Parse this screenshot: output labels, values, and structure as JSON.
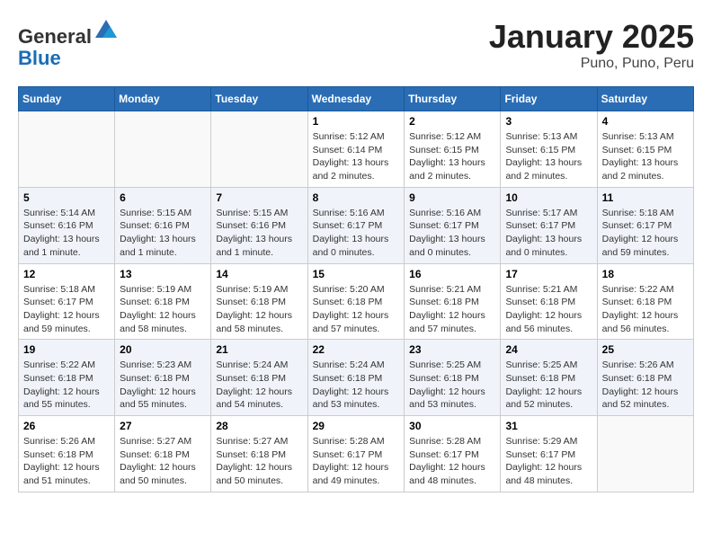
{
  "header": {
    "logo_general": "General",
    "logo_blue": "Blue",
    "month": "January 2025",
    "location": "Puno, Puno, Peru"
  },
  "weekdays": [
    "Sunday",
    "Monday",
    "Tuesday",
    "Wednesday",
    "Thursday",
    "Friday",
    "Saturday"
  ],
  "weeks": [
    [
      {
        "day": "",
        "info": ""
      },
      {
        "day": "",
        "info": ""
      },
      {
        "day": "",
        "info": ""
      },
      {
        "day": "1",
        "info": "Sunrise: 5:12 AM\nSunset: 6:14 PM\nDaylight: 13 hours and 2 minutes."
      },
      {
        "day": "2",
        "info": "Sunrise: 5:12 AM\nSunset: 6:15 PM\nDaylight: 13 hours and 2 minutes."
      },
      {
        "day": "3",
        "info": "Sunrise: 5:13 AM\nSunset: 6:15 PM\nDaylight: 13 hours and 2 minutes."
      },
      {
        "day": "4",
        "info": "Sunrise: 5:13 AM\nSunset: 6:15 PM\nDaylight: 13 hours and 2 minutes."
      }
    ],
    [
      {
        "day": "5",
        "info": "Sunrise: 5:14 AM\nSunset: 6:16 PM\nDaylight: 13 hours and 1 minute."
      },
      {
        "day": "6",
        "info": "Sunrise: 5:15 AM\nSunset: 6:16 PM\nDaylight: 13 hours and 1 minute."
      },
      {
        "day": "7",
        "info": "Sunrise: 5:15 AM\nSunset: 6:16 PM\nDaylight: 13 hours and 1 minute."
      },
      {
        "day": "8",
        "info": "Sunrise: 5:16 AM\nSunset: 6:17 PM\nDaylight: 13 hours and 0 minutes."
      },
      {
        "day": "9",
        "info": "Sunrise: 5:16 AM\nSunset: 6:17 PM\nDaylight: 13 hours and 0 minutes."
      },
      {
        "day": "10",
        "info": "Sunrise: 5:17 AM\nSunset: 6:17 PM\nDaylight: 13 hours and 0 minutes."
      },
      {
        "day": "11",
        "info": "Sunrise: 5:18 AM\nSunset: 6:17 PM\nDaylight: 12 hours and 59 minutes."
      }
    ],
    [
      {
        "day": "12",
        "info": "Sunrise: 5:18 AM\nSunset: 6:17 PM\nDaylight: 12 hours and 59 minutes."
      },
      {
        "day": "13",
        "info": "Sunrise: 5:19 AM\nSunset: 6:18 PM\nDaylight: 12 hours and 58 minutes."
      },
      {
        "day": "14",
        "info": "Sunrise: 5:19 AM\nSunset: 6:18 PM\nDaylight: 12 hours and 58 minutes."
      },
      {
        "day": "15",
        "info": "Sunrise: 5:20 AM\nSunset: 6:18 PM\nDaylight: 12 hours and 57 minutes."
      },
      {
        "day": "16",
        "info": "Sunrise: 5:21 AM\nSunset: 6:18 PM\nDaylight: 12 hours and 57 minutes."
      },
      {
        "day": "17",
        "info": "Sunrise: 5:21 AM\nSunset: 6:18 PM\nDaylight: 12 hours and 56 minutes."
      },
      {
        "day": "18",
        "info": "Sunrise: 5:22 AM\nSunset: 6:18 PM\nDaylight: 12 hours and 56 minutes."
      }
    ],
    [
      {
        "day": "19",
        "info": "Sunrise: 5:22 AM\nSunset: 6:18 PM\nDaylight: 12 hours and 55 minutes."
      },
      {
        "day": "20",
        "info": "Sunrise: 5:23 AM\nSunset: 6:18 PM\nDaylight: 12 hours and 55 minutes."
      },
      {
        "day": "21",
        "info": "Sunrise: 5:24 AM\nSunset: 6:18 PM\nDaylight: 12 hours and 54 minutes."
      },
      {
        "day": "22",
        "info": "Sunrise: 5:24 AM\nSunset: 6:18 PM\nDaylight: 12 hours and 53 minutes."
      },
      {
        "day": "23",
        "info": "Sunrise: 5:25 AM\nSunset: 6:18 PM\nDaylight: 12 hours and 53 minutes."
      },
      {
        "day": "24",
        "info": "Sunrise: 5:25 AM\nSunset: 6:18 PM\nDaylight: 12 hours and 52 minutes."
      },
      {
        "day": "25",
        "info": "Sunrise: 5:26 AM\nSunset: 6:18 PM\nDaylight: 12 hours and 52 minutes."
      }
    ],
    [
      {
        "day": "26",
        "info": "Sunrise: 5:26 AM\nSunset: 6:18 PM\nDaylight: 12 hours and 51 minutes."
      },
      {
        "day": "27",
        "info": "Sunrise: 5:27 AM\nSunset: 6:18 PM\nDaylight: 12 hours and 50 minutes."
      },
      {
        "day": "28",
        "info": "Sunrise: 5:27 AM\nSunset: 6:18 PM\nDaylight: 12 hours and 50 minutes."
      },
      {
        "day": "29",
        "info": "Sunrise: 5:28 AM\nSunset: 6:17 PM\nDaylight: 12 hours and 49 minutes."
      },
      {
        "day": "30",
        "info": "Sunrise: 5:28 AM\nSunset: 6:17 PM\nDaylight: 12 hours and 48 minutes."
      },
      {
        "day": "31",
        "info": "Sunrise: 5:29 AM\nSunset: 6:17 PM\nDaylight: 12 hours and 48 minutes."
      },
      {
        "day": "",
        "info": ""
      }
    ]
  ]
}
